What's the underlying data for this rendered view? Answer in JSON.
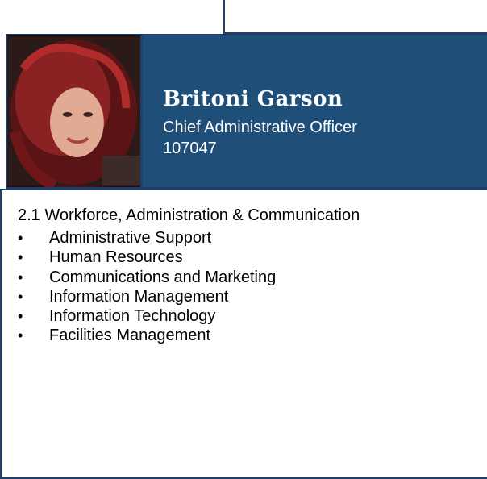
{
  "profile": {
    "name": "Britoni Garson",
    "position": "Chief Administrative Officer",
    "employee_id": "107047",
    "photo_icon": "portrait-photo"
  },
  "details": {
    "heading": "2.1 Workforce, Administration & Communication",
    "bullet": "•",
    "items": [
      "Administrative Support",
      "Human Resources",
      "Communications and Marketing",
      "Information Management",
      "Information Technology",
      "Facilities Management"
    ]
  },
  "colors": {
    "header_background": "#1f4e79",
    "border": "#1f3f66",
    "header_text": "#ffffff"
  }
}
